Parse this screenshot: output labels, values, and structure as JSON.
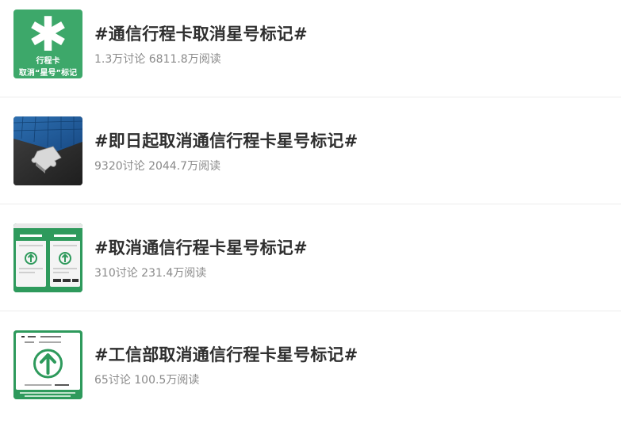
{
  "topics": [
    {
      "title": "#通信行程卡取消星号标记#",
      "meta": "1.3万讨论 6811.8万阅读",
      "thumb_caption_line1": "行程卡",
      "thumb_caption_line2": "取消“星号”标记",
      "thumb_icon": "asterisk-icon"
    },
    {
      "title": "#即日起取消通信行程卡星号标记#",
      "meta": "9320讨论 2044.7万阅读",
      "thumb_icon": "puzzle-image"
    },
    {
      "title": "#取消通信行程卡星号标记#",
      "meta": "310讨论 231.4万阅读",
      "thumb_icon": "phone-screens-image"
    },
    {
      "title": "#工信部取消通信行程卡星号标记#",
      "meta": "65讨论 100.5万阅读",
      "thumb_icon": "green-arrow-card-image"
    }
  ],
  "colors": {
    "title": "#2f2f2f",
    "meta": "#8a8a8a",
    "brand_green": "#3da86a",
    "divider": "#ececec"
  }
}
